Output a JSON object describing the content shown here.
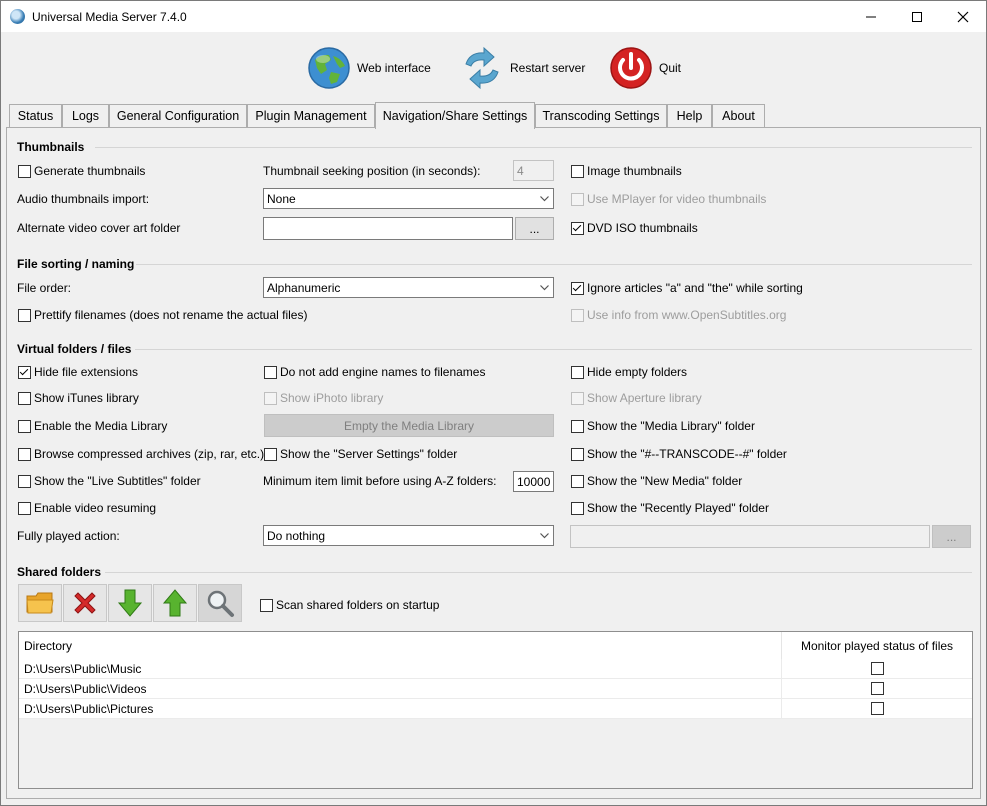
{
  "window": {
    "title": "Universal Media Server 7.4.0",
    "minimize_glyph": "—",
    "maximize_glyph": "☐",
    "close_glyph": "✕"
  },
  "toolbar": {
    "web_interface": "Web interface",
    "restart_server": "Restart server",
    "quit": "Quit"
  },
  "tabs": [
    {
      "label": "Status"
    },
    {
      "label": "Logs"
    },
    {
      "label": "General Configuration"
    },
    {
      "label": "Plugin Management"
    },
    {
      "label": "Navigation/Share Settings"
    },
    {
      "label": "Transcoding Settings"
    },
    {
      "label": "Help"
    },
    {
      "label": "About"
    }
  ],
  "active_tab": "Navigation/Share Settings",
  "thumbnails": {
    "header": "Thumbnails",
    "generate_thumbnails": "Generate thumbnails",
    "seek_label": "Thumbnail seeking position (in seconds):",
    "seek_value": "4",
    "image_thumbnails": "Image thumbnails",
    "audio_import_label": "Audio thumbnails import:",
    "audio_import_value": "None",
    "use_mplayer": "Use MPlayer for video thumbnails",
    "alt_cover_label": "Alternate video cover art folder",
    "alt_cover_value": "",
    "browse_label": "...",
    "dvd_iso": "DVD ISO thumbnails"
  },
  "sorting": {
    "header": "File sorting / naming",
    "file_order_label": "File order:",
    "file_order_value": "Alphanumeric",
    "ignore_articles": "Ignore articles \"a\" and \"the\" while sorting",
    "prettify": "Prettify filenames (does not rename the actual files)",
    "opensubtitles": "Use info from www.OpenSubtitles.org"
  },
  "virtual": {
    "header": "Virtual folders / files",
    "hide_ext": "Hide file extensions",
    "no_engine_names": "Do not add engine names to filenames",
    "hide_empty": "Hide empty folders",
    "itunes": "Show iTunes library",
    "iphoto": "Show iPhoto library",
    "aperture": "Show Aperture library",
    "enable_media_lib": "Enable the Media Library",
    "empty_media_lib": "Empty the Media Library",
    "show_media_lib": "Show the \"Media Library\" folder",
    "browse_archives": "Browse compressed archives (zip, rar, etc.)",
    "server_settings": "Show the \"Server Settings\" folder",
    "transcode_folder": "Show the \"#--TRANSCODE--#\" folder",
    "live_subtitles": "Show the \"Live Subtitles\" folder",
    "min_item_label": "Minimum item limit before using A-Z folders:",
    "min_item_value": "10000",
    "new_media": "Show the \"New Media\" folder",
    "video_resume": "Enable video resuming",
    "recently_played": "Show the \"Recently Played\" folder",
    "fully_played_label": "Fully played action:",
    "fully_played_value": "Do nothing",
    "fully_played_path": "",
    "fully_played_browse": "..."
  },
  "shared": {
    "header": "Shared folders",
    "buttons": [
      "folder-open-icon",
      "delete-x-icon",
      "arrow-down-icon",
      "arrow-up-icon",
      "magnifier-icon"
    ],
    "scan_on_startup": "Scan shared folders on startup",
    "columns": [
      "Directory",
      "Monitor played status of files"
    ],
    "rows": [
      {
        "directory": "D:\\Users\\Public\\Music",
        "monitor": false
      },
      {
        "directory": "D:\\Users\\Public\\Videos",
        "monitor": false
      },
      {
        "directory": "D:\\Users\\Public\\Pictures",
        "monitor": false
      }
    ]
  }
}
